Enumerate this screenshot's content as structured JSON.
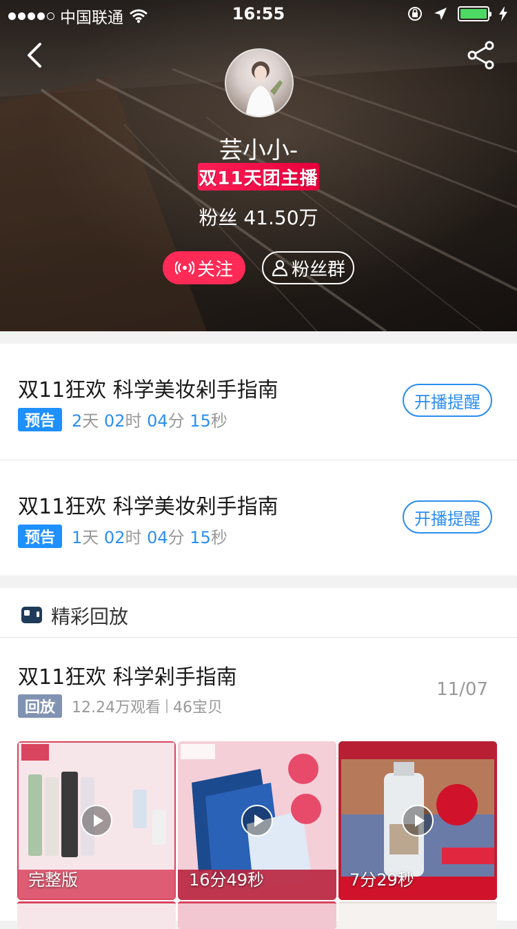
{
  "status_bar": {
    "carrier": "中国联通",
    "time": "16:55"
  },
  "hero": {
    "anchor_name": "芸小小-",
    "badge": "双11天团主播",
    "fans": "粉丝 41.50万",
    "follow_label": "关注",
    "fan_group_label": "粉丝群"
  },
  "previews": [
    {
      "title": "双11狂欢 科学美妆剁手指南",
      "tag": "预告",
      "countdown": [
        {
          "n": "2",
          "u": "天"
        },
        {
          "n": "02",
          "u": "时"
        },
        {
          "n": "04",
          "u": "分"
        },
        {
          "n": "15",
          "u": "秒"
        }
      ],
      "remind_label": "开播提醒"
    },
    {
      "title": "双11狂欢 科学美妆剁手指南",
      "tag": "预告",
      "countdown": [
        {
          "n": "1",
          "u": "天"
        },
        {
          "n": "02",
          "u": "时"
        },
        {
          "n": "04",
          "u": "分"
        },
        {
          "n": "15",
          "u": "秒"
        }
      ],
      "remind_label": "开播提醒"
    }
  ],
  "replay": {
    "section_title": "精彩回放",
    "title": "双11狂欢 科学剁手指南",
    "tag": "回放",
    "views": "12.24万观看",
    "items": "46宝贝",
    "date": "11/07",
    "thumbs": [
      {
        "caption": "完整版",
        "bg": "#f2d8de"
      },
      {
        "caption": "16分49秒",
        "bg": "#f3c7d1"
      },
      {
        "caption": "7分29秒",
        "bg": "#8c1d2a"
      }
    ]
  },
  "colors": {
    "accent_red": "#ff2a55",
    "accent_blue": "#2b8ef0",
    "battery": "#4cd964"
  }
}
